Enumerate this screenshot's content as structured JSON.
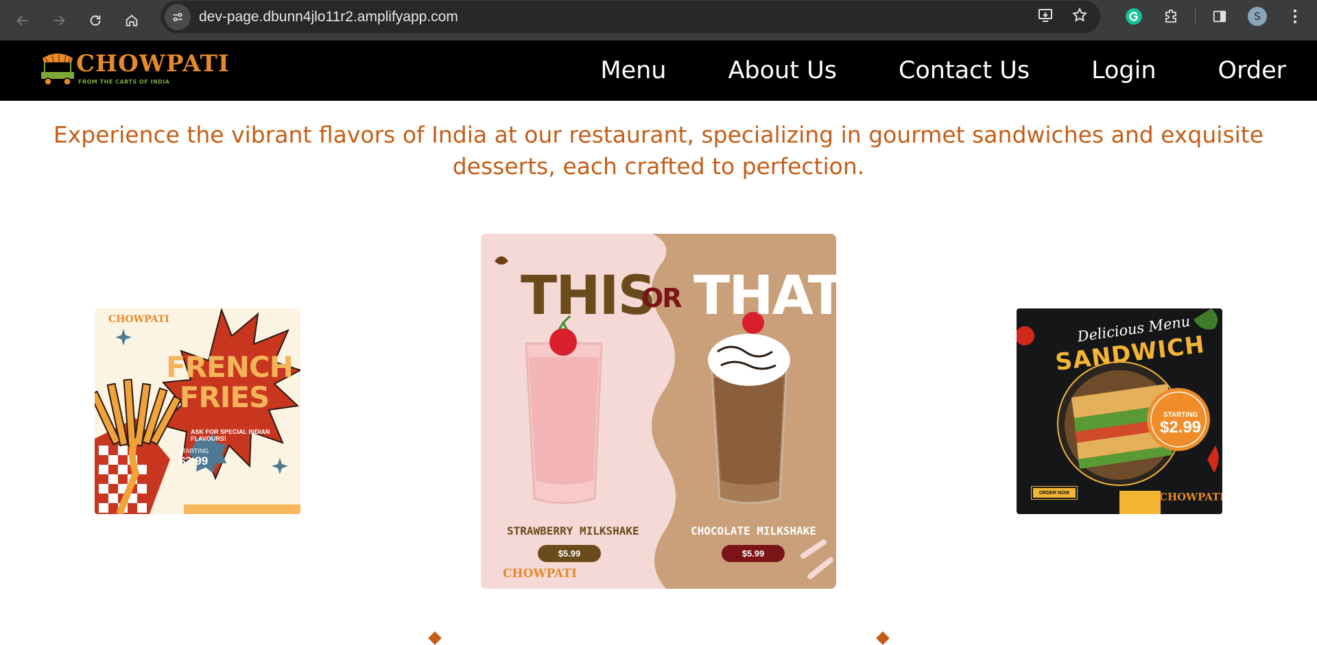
{
  "browser": {
    "url": "dev-page.dbunn4jlo11r2.amplifyapp.com",
    "profile_initial": "S",
    "icons": [
      "back-icon",
      "forward-icon",
      "reload-icon",
      "home-icon",
      "site-info-icon",
      "install-app-icon",
      "bookmark-star-icon",
      "grammarly-icon",
      "extensions-icon",
      "side-panel-icon",
      "profile-avatar",
      "more-menu-icon"
    ]
  },
  "site": {
    "logo": {
      "name": "CHOWPATI",
      "tagline": "FROM THE CARTS OF INDIA"
    },
    "nav": [
      "Menu",
      "About Us",
      "Contact Us",
      "Login",
      "Order"
    ],
    "hero_text": "Experience the vibrant flavors of India at our restaurant, specializing in gourmet sandwiches and exquisite desserts, each crafted to perfection."
  },
  "cards": {
    "fries": {
      "logo": "CHOWPATI",
      "title": "FRENCH FRIES",
      "note": "ASK FOR SPECIAL INDIAN FLAVOURS!",
      "starting": "STARTING",
      "price": "$3.99"
    },
    "shakes": {
      "this": "THIS",
      "or": "OR",
      "that": "THAT",
      "left_name": "STRAWBERRY MILKSHAKE",
      "left_price": "$5.99",
      "right_name": "CHOCOLATE MILKSHAKE",
      "right_price": "$5.99",
      "logo": "CHOWPATI"
    },
    "sandwich": {
      "subtitle": "Delicious Menu",
      "title": "SANDWICH",
      "starting": "STARTING",
      "price": "$2.99",
      "order": "ORDER NOW",
      "logo": "CHOWPATI"
    }
  },
  "colors": {
    "accent": "#c55d15",
    "nav_bg": "#000000",
    "strawberry_bg": "#f5d9d6",
    "chocolate_bg": "#c9a07a"
  }
}
